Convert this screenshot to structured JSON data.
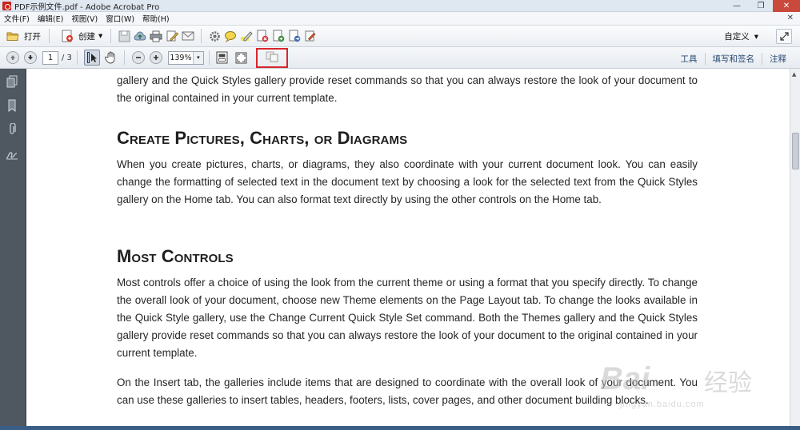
{
  "window": {
    "title": "PDF示例文件.pdf - Adobe Acrobat Pro",
    "min_label": "—",
    "max_label": "❐",
    "close_label": "✕"
  },
  "menu": {
    "items": [
      "文件(F)",
      "编辑(E)",
      "视图(V)",
      "窗口(W)",
      "帮助(H)"
    ],
    "close_label": "✕"
  },
  "toolbar": {
    "open_label": "打开",
    "create_label": "创建",
    "create_arrow": "▾",
    "customize_label": "自定义",
    "customize_arrow": "▾"
  },
  "navbar": {
    "page_current": "1",
    "page_total": "/ 3",
    "zoom_value": "139%",
    "zoom_arrow": "▾",
    "links": [
      "工具",
      "填写和签名",
      "注释"
    ]
  },
  "document": {
    "p0": "gallery and the Quick Styles gallery provide reset commands so that you can always restore the look of your document to the original contained in your current template.",
    "h1": "Create Pictures, Charts, or Diagrams",
    "p1": "When you create pictures, charts, or diagrams, they also coordinate with your current document look. You can easily change the formatting of selected text in the document text by choosing a look for the selected text from the Quick Styles gallery on the Home tab. You can also format text directly by using the other controls on the Home tab.",
    "h2": "Most Controls",
    "p2": "Most controls offer a choice of using the look from the current theme or using a format that you specify directly. To change the overall look of your document, choose new Theme elements on the Page Layout tab. To change the looks available in the Quick Style gallery, use the Change Current Quick Style Set command. Both the Themes gallery and the Quick Styles gallery provide reset commands so that you can always restore the look of your document to the original contained in your current template.",
    "p3": "On the Insert tab, the galleries include items that are designed to coordinate with the overall look of your document. You can use these galleries to insert tables, headers, footers, lists, cover pages, and other document building blocks."
  },
  "watermark": {
    "brand": "Bai",
    "cn": "经验",
    "url": "jingyan.baidu.com"
  },
  "colors": {
    "highlight": "#d9262b",
    "nav_panel": "#4f5761",
    "link": "#2b4a74"
  }
}
